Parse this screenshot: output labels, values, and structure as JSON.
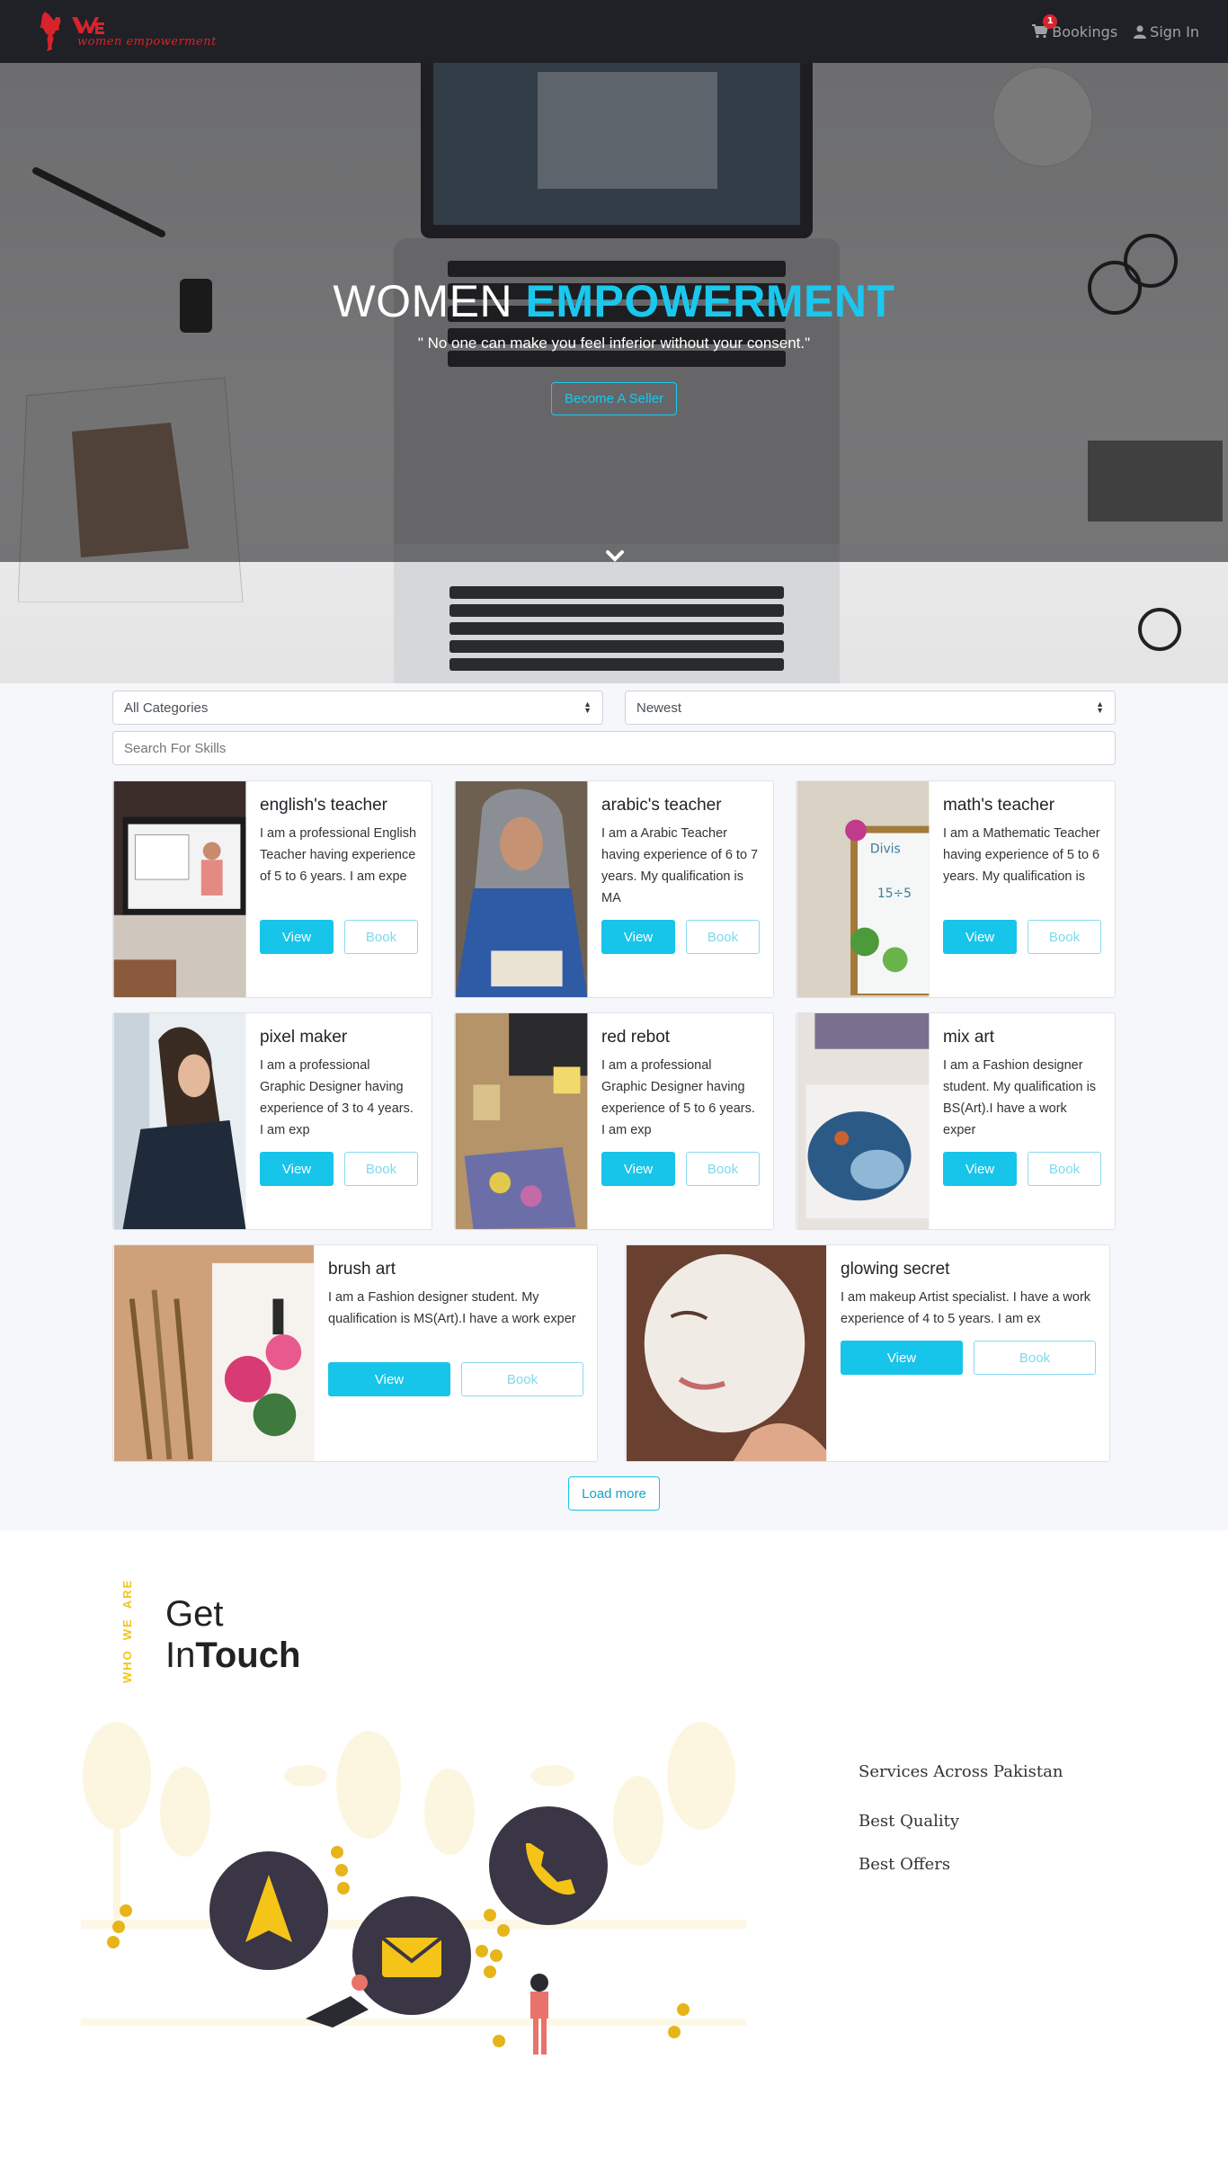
{
  "navbar": {
    "brand_text": "women empowerment",
    "bookings_label": "Bookings",
    "bookings_badge": "1",
    "signin_label": "Sign In"
  },
  "hero": {
    "title_plain": "WOMEN ",
    "title_accent": "EMPOWERMENT",
    "quote": "\" No one can make you feel inferior without your consent.\"",
    "cta_label": "Become A Seller"
  },
  "filters": {
    "category_value": "All Categories",
    "sort_value": "Newest",
    "search_placeholder": "Search For Skills"
  },
  "cards": [
    {
      "title": "english's teacher",
      "text": "I am a professional English Teacher having experience of 5 to 6 years. I am expe",
      "view": "View",
      "book": "Book"
    },
    {
      "title": "arabic's teacher",
      "text": "I am a Arabic Teacher having experience of 6 to 7 years. My qualification is MA",
      "view": "View",
      "book": "Book"
    },
    {
      "title": "math's teacher",
      "text": "I am a Mathematic Teacher having experience of 5 to 6 years. My qualification is",
      "view": "View",
      "book": "Book"
    },
    {
      "title": "pixel maker",
      "text": "I am a professional Graphic Designer having experience of 3 to 4 years. I am exp",
      "view": "View",
      "book": "Book"
    },
    {
      "title": "red rebot",
      "text": "I am a professional Graphic Designer having experience of 5 to 6 years. I am exp",
      "view": "View",
      "book": "Book"
    },
    {
      "title": "mix art",
      "text": "I am a Fashion designer student. My qualification is BS(Art).I have a work exper",
      "view": "View",
      "book": "Book"
    },
    {
      "title": "brush art",
      "text": "I am a Fashion designer student. My qualification is MS(Art).I have a work exper",
      "view": "View",
      "book": "Book"
    },
    {
      "title": "glowing secret",
      "text": "I am makeup Artist specialist. I have a work experience of 4 to 5 years. I am ex",
      "view": "View",
      "book": "Book"
    }
  ],
  "load_more_label": "Load more",
  "touch": {
    "who": "WHO",
    "we": "WE",
    "are": "ARE",
    "title_line1": "Get",
    "title_line2_plain": "In",
    "title_line2_bold": "Touch",
    "items": [
      "Services Across Pakistan",
      "Best Quality",
      "Best Offers"
    ]
  },
  "colors": {
    "accent": "#17c4ea",
    "navbar": "#1f2127",
    "brand_red": "#d8232a",
    "yellow": "#f4c418"
  }
}
